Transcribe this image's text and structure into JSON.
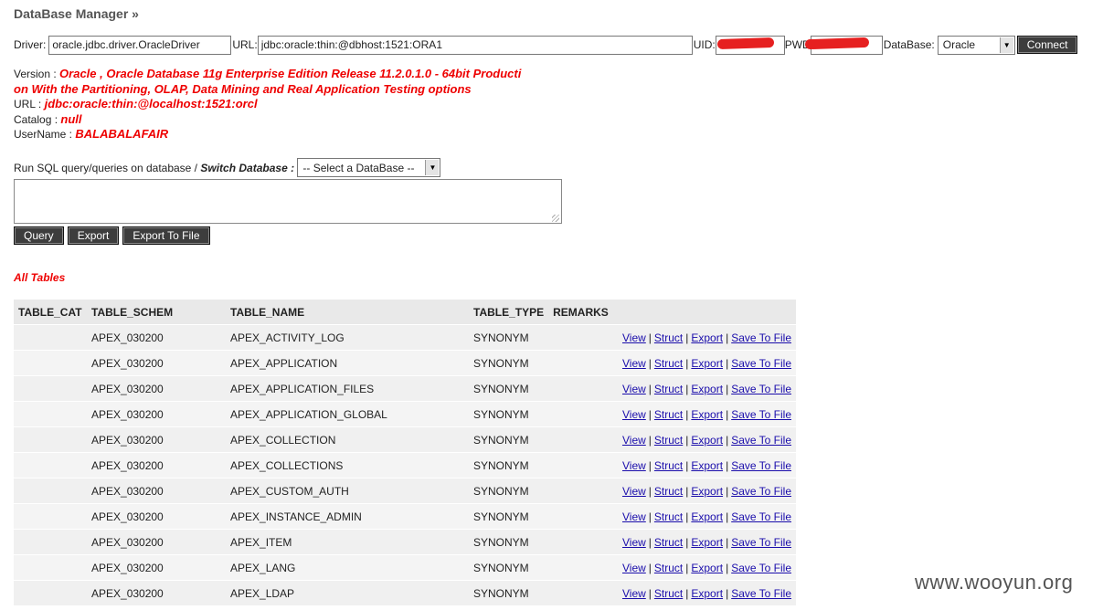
{
  "title": "DataBase Manager »",
  "connection": {
    "driver_label": "Driver:",
    "driver_value": "oracle.jdbc.driver.OracleDriver",
    "url_label": "URL:",
    "url_value": "jdbc:oracle:thin:@dbhost:1521:ORA1",
    "uid_label": "UID:",
    "pwd_label": "PWD",
    "database_label": "DataBase:",
    "database_selected": "Oracle",
    "connect_label": "Connect",
    "redact_color": "#e62020"
  },
  "info": {
    "version_label": "Version :",
    "version_value_line1": "Oracle , Oracle Database 11g Enterprise Edition Release 11.2.0.1.0 - 64bit Producti",
    "version_value_line2": "on With the Partitioning, OLAP, Data Mining and Real Application Testing options",
    "url_label": "URL :",
    "url_value": "jdbc:oracle:thin:@localhost:1521:orcl",
    "catalog_label": "Catalog :",
    "catalog_value": "null",
    "username_label": "UserName :",
    "username_value": "BALABALAFAIR"
  },
  "sql": {
    "run_label": "Run SQL query/queries on database /",
    "switch_label": "Switch Database :",
    "switch_selected": "-- Select a DataBase --",
    "query_button": "Query",
    "export_button": "Export",
    "export_file_button": "Export To File"
  },
  "tables": {
    "heading": "All Tables",
    "columns": [
      "TABLE_CAT",
      "TABLE_SCHEM",
      "TABLE_NAME",
      "TABLE_TYPE",
      "REMARKS"
    ],
    "actions": {
      "view": "View",
      "struct": "Struct",
      "export": "Export",
      "save": "Save To File",
      "sep": "|"
    },
    "rows": [
      {
        "cat": "",
        "schem": "APEX_030200",
        "name": "APEX_ACTIVITY_LOG",
        "type": "SYNONYM",
        "remarks": ""
      },
      {
        "cat": "",
        "schem": "APEX_030200",
        "name": "APEX_APPLICATION",
        "type": "SYNONYM",
        "remarks": ""
      },
      {
        "cat": "",
        "schem": "APEX_030200",
        "name": "APEX_APPLICATION_FILES",
        "type": "SYNONYM",
        "remarks": ""
      },
      {
        "cat": "",
        "schem": "APEX_030200",
        "name": "APEX_APPLICATION_GLOBAL",
        "type": "SYNONYM",
        "remarks": ""
      },
      {
        "cat": "",
        "schem": "APEX_030200",
        "name": "APEX_COLLECTION",
        "type": "SYNONYM",
        "remarks": ""
      },
      {
        "cat": "",
        "schem": "APEX_030200",
        "name": "APEX_COLLECTIONS",
        "type": "SYNONYM",
        "remarks": ""
      },
      {
        "cat": "",
        "schem": "APEX_030200",
        "name": "APEX_CUSTOM_AUTH",
        "type": "SYNONYM",
        "remarks": ""
      },
      {
        "cat": "",
        "schem": "APEX_030200",
        "name": "APEX_INSTANCE_ADMIN",
        "type": "SYNONYM",
        "remarks": ""
      },
      {
        "cat": "",
        "schem": "APEX_030200",
        "name": "APEX_ITEM",
        "type": "SYNONYM",
        "remarks": ""
      },
      {
        "cat": "",
        "schem": "APEX_030200",
        "name": "APEX_LANG",
        "type": "SYNONYM",
        "remarks": ""
      },
      {
        "cat": "",
        "schem": "APEX_030200",
        "name": "APEX_LDAP",
        "type": "SYNONYM",
        "remarks": ""
      }
    ]
  },
  "watermark": "www.wooyun.org"
}
